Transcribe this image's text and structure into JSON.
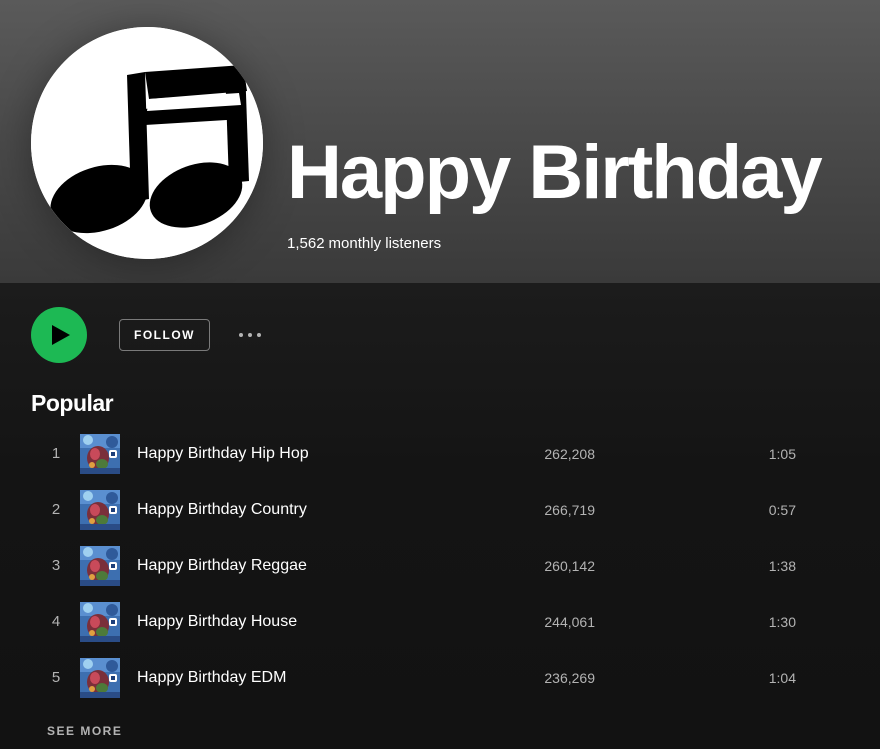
{
  "artist": {
    "name": "Happy Birthday",
    "monthly_listeners": "1,562",
    "monthly_listeners_suffix": "monthly listeners",
    "avatar_icon": "music-notes-icon"
  },
  "actions": {
    "play_icon": "play-icon",
    "follow_label": "FOLLOW",
    "more_icon": "more-options-icon"
  },
  "popular": {
    "title": "Popular",
    "tracks": [
      {
        "index": "1",
        "title": "Happy Birthday Hip Hop",
        "plays": "262,208",
        "duration": "1:05"
      },
      {
        "index": "2",
        "title": "Happy Birthday Country",
        "plays": "266,719",
        "duration": "0:57"
      },
      {
        "index": "3",
        "title": "Happy Birthday Reggae",
        "plays": "260,142",
        "duration": "1:38"
      },
      {
        "index": "4",
        "title": "Happy Birthday House",
        "plays": "244,061",
        "duration": "1:30"
      },
      {
        "index": "5",
        "title": "Happy Birthday EDM",
        "plays": "236,269",
        "duration": "1:04"
      }
    ],
    "see_more_label": "SEE MORE"
  },
  "colors": {
    "accent": "#1db954",
    "background": "#121212",
    "text_secondary": "#b3b3b3"
  }
}
